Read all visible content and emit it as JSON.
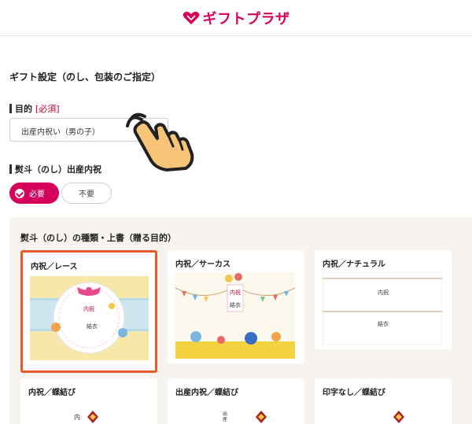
{
  "header": {
    "logo_text": "ギフトプラザ",
    "brand_color": "#d6005b"
  },
  "page": {
    "title": "ギフト設定（のし、包装のご指定）"
  },
  "purpose": {
    "label": "目的",
    "required_tag": "[必須]",
    "select_value": "出産内祝い（男の子）"
  },
  "noshi": {
    "label": "熨斗（のし）出産内祝",
    "options": [
      "必要",
      "不要"
    ],
    "selected": "必要"
  },
  "noshi_types": {
    "title": "熨斗（のし）の種類・上書（贈る目的）",
    "cards": [
      {
        "label": "内祝／レース",
        "selected": true,
        "art": {
          "line1": "内祝",
          "line2": "結衣"
        }
      },
      {
        "label": "内祝／サーカス",
        "selected": false,
        "art": {
          "line1": "内祝",
          "line2": "結衣"
        }
      },
      {
        "label": "内祝／ナチュラル",
        "selected": false,
        "art": {
          "line1": "内祝",
          "line2": "結衣"
        }
      },
      {
        "label": "内祝／蝶結び",
        "selected": false,
        "art": {
          "line1": "内"
        }
      },
      {
        "label": "出産内祝／蝶結び",
        "selected": false,
        "art": {
          "line1": "出産"
        }
      },
      {
        "label": "印字なし／蝶結び",
        "selected": false,
        "art": {
          "line1": ""
        }
      }
    ]
  },
  "colors": {
    "accent": "#d5005c",
    "selected_border": "#e85a2a",
    "panel_bg": "#f7f4ef"
  },
  "icons": {
    "cursor": "hand-pointer-icon",
    "check": "check-icon",
    "logo": "heart-logo-icon"
  }
}
